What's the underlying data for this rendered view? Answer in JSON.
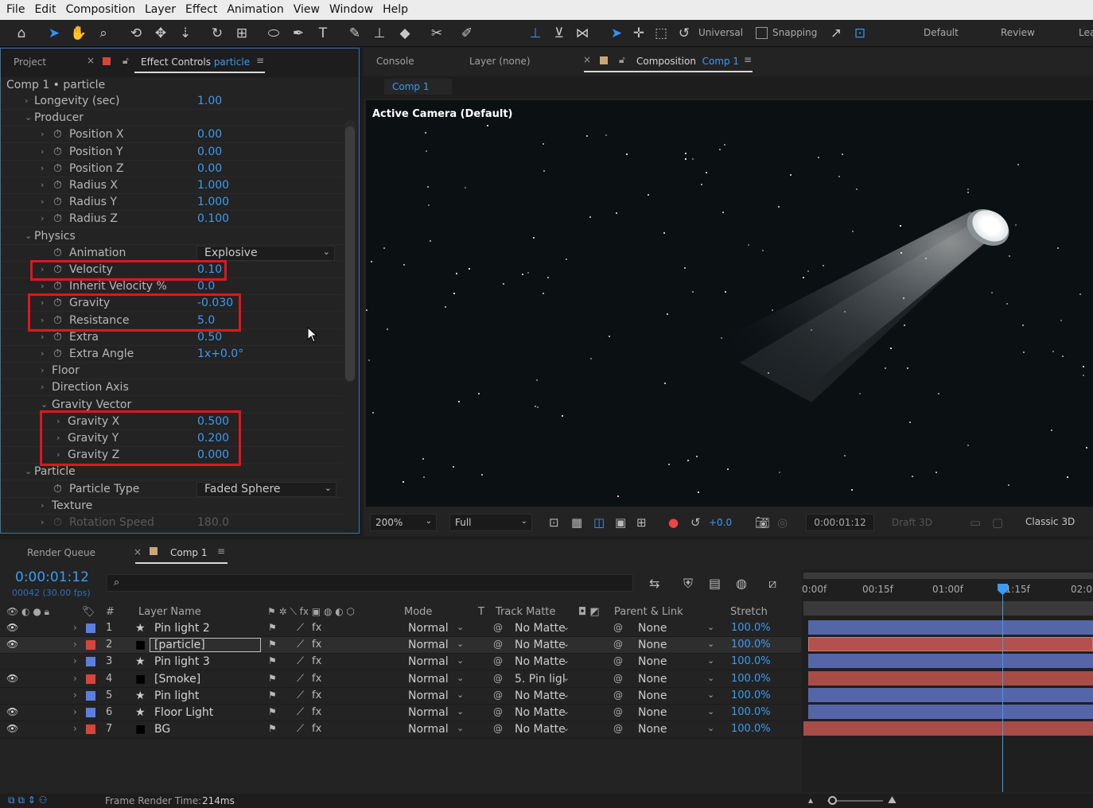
{
  "menu": [
    "File",
    "Edit",
    "Composition",
    "Layer",
    "Effect",
    "Animation",
    "View",
    "Window",
    "Help"
  ],
  "toolbar": {
    "universal": "Universal",
    "snapping": "Snapping",
    "workspaces": [
      "Default",
      "Review",
      "Lea"
    ]
  },
  "left_panel": {
    "tab_project": "Project",
    "tab_effect_controls": "Effect Controls",
    "tab_effect_layer": "particle",
    "breadcrumb": "Comp 1 • particle",
    "rows": [
      {
        "label": "Longevity (sec)",
        "value": "1.00"
      },
      {
        "label": "Producer"
      },
      {
        "label": "Position X",
        "value": "0.00"
      },
      {
        "label": "Position Y",
        "value": "0.00"
      },
      {
        "label": "Position Z",
        "value": "0.00"
      },
      {
        "label": "Radius X",
        "value": "1.000"
      },
      {
        "label": "Radius Y",
        "value": "1.000"
      },
      {
        "label": "Radius Z",
        "value": "0.100"
      },
      {
        "label": "Physics"
      },
      {
        "label": "Animation",
        "value": "Explosive"
      },
      {
        "label": "Velocity",
        "value": "0.10"
      },
      {
        "label": "Inherit Velocity %",
        "value": "0.0"
      },
      {
        "label": "Gravity",
        "value": "-0.030"
      },
      {
        "label": "Resistance",
        "value": "5.0"
      },
      {
        "label": "Extra",
        "value": "0.50"
      },
      {
        "label": "Extra Angle",
        "value": "1x+0.0°"
      },
      {
        "label": "Floor"
      },
      {
        "label": "Direction Axis"
      },
      {
        "label": "Gravity Vector"
      },
      {
        "label": "Gravity X",
        "value": "0.500"
      },
      {
        "label": "Gravity Y",
        "value": "0.200"
      },
      {
        "label": "Gravity Z",
        "value": "0.000"
      },
      {
        "label": "Particle"
      },
      {
        "label": "Particle Type",
        "value": "Faded Sphere"
      },
      {
        "label": "Texture"
      },
      {
        "label": "Rotation Speed",
        "value": "180.0"
      }
    ]
  },
  "comp_panel": {
    "tab_console": "Console",
    "tab_layer": "Layer (none)",
    "tab_composition": "Composition",
    "tab_comp_name": "Comp 1",
    "subtab": "Comp 1",
    "camera_label": "Active Camera (Default)"
  },
  "viewer_controls": {
    "zoom": "200%",
    "resolution": "Full",
    "exposure": "+0.0",
    "timecode": "0:00:01:12",
    "draft": "Draft 3D",
    "renderer": "Classic 3D"
  },
  "timeline": {
    "tab_render_queue": "Render Queue",
    "tab_comp": "Comp 1",
    "timecode": "0:00:01:12",
    "frames": "00042 (30.00 fps)",
    "search_placeholder": "",
    "headers": {
      "number": "#",
      "layer_name": "Layer Name",
      "mode": "Mode",
      "t": "T",
      "track_matte": "Track Matte",
      "parent": "Parent & Link",
      "stretch": "Stretch"
    },
    "ruler": [
      "0:00f",
      "00:15f",
      "01:00f",
      "01:15f",
      "02:00"
    ],
    "layers": [
      {
        "num": "1",
        "name": "Pin light 2",
        "mode": "Normal",
        "matte": "No Matte",
        "parent": "None",
        "stretch": "100.0%",
        "color": "#5b7fe0",
        "bar": "#5566a8"
      },
      {
        "num": "2",
        "name": "[particle]",
        "mode": "Normal",
        "matte": "No Matte",
        "parent": "None",
        "stretch": "100.0%",
        "color": "#d8433c",
        "bar": "#b3514e"
      },
      {
        "num": "3",
        "name": "Pin light 3",
        "mode": "Normal",
        "matte": "No Matte",
        "parent": "None",
        "stretch": "100.0%",
        "color": "#5b7fe0",
        "bar": "#5566a8"
      },
      {
        "num": "4",
        "name": "[Smoke]",
        "mode": "Normal",
        "matte": "5. Pin ligl",
        "parent": "None",
        "stretch": "100.0%",
        "color": "#d8433c",
        "bar": "#a84c48"
      },
      {
        "num": "5",
        "name": "Pin light",
        "mode": "Normal",
        "matte": "No Matte",
        "parent": "None",
        "stretch": "100.0%",
        "color": "#5b7fe0",
        "bar": "#5566a8"
      },
      {
        "num": "6",
        "name": "Floor Light",
        "mode": "Normal",
        "matte": "No Matte",
        "parent": "None",
        "stretch": "100.0%",
        "color": "#5b7fe0",
        "bar": "#5566a8"
      },
      {
        "num": "7",
        "name": "BG",
        "mode": "Normal",
        "matte": "No Matte",
        "parent": "None",
        "stretch": "100.0%",
        "color": "#d8433c",
        "bar": "#a84c48"
      }
    ]
  },
  "status": {
    "label": "Frame Render Time:",
    "value": "214ms"
  }
}
